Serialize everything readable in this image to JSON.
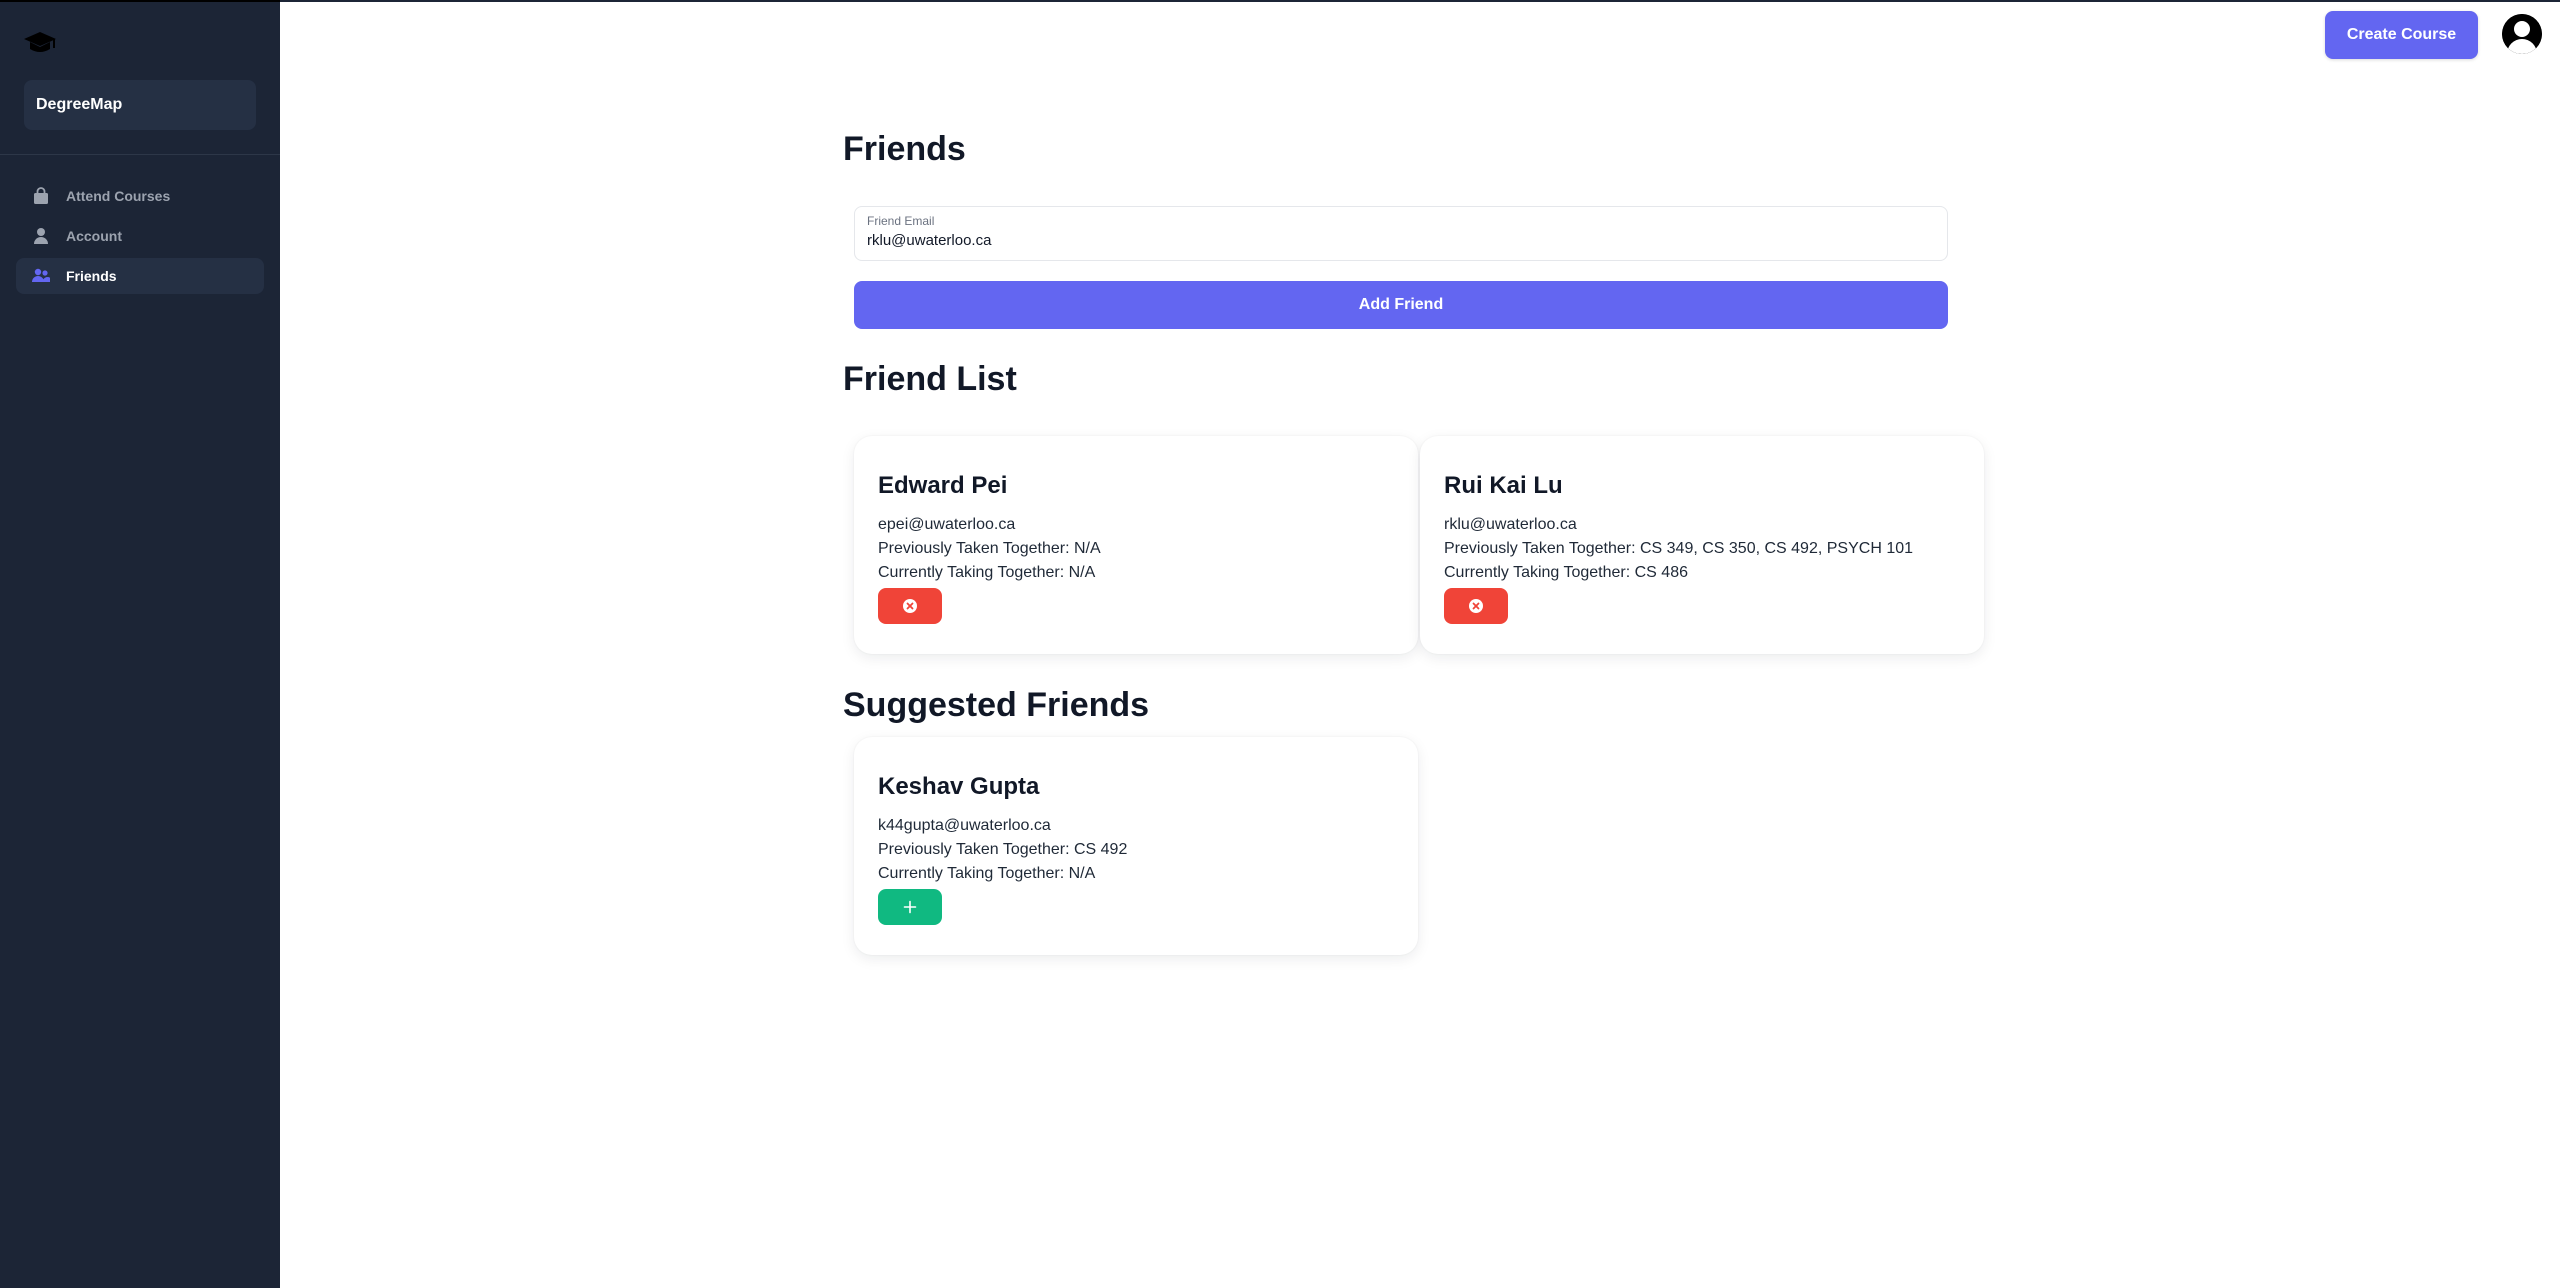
{
  "sidebar": {
    "workspace_name": "DegreeMap",
    "items": [
      {
        "label": "Attend Courses",
        "icon": "shopping-bag-icon",
        "active": false
      },
      {
        "label": "Account",
        "icon": "user-icon",
        "active": false
      },
      {
        "label": "Friends",
        "icon": "users-icon",
        "active": true
      }
    ]
  },
  "header": {
    "create_course_label": "Create Course"
  },
  "friends_page": {
    "title": "Friends",
    "email_label": "Friend Email",
    "email_value": "rklu@uwaterloo.ca",
    "add_friend_label": "Add Friend",
    "friend_list_title": "Friend List",
    "suggested_title": "Suggested Friends",
    "friends": [
      {
        "name": "Edward Pei",
        "email": "epei@uwaterloo.ca",
        "previously": "Previously Taken Together: N/A",
        "currently": "Currently Taking Together: N/A"
      },
      {
        "name": "Rui Kai Lu",
        "email": "rklu@uwaterloo.ca",
        "previously": "Previously Taken Together: CS 349, CS 350, CS 492, PSYCH 101",
        "currently": "Currently Taking Together: CS 486"
      }
    ],
    "suggested": [
      {
        "name": "Keshav Gupta",
        "email": "k44gupta@uwaterloo.ca",
        "previously": "Previously Taken Together: CS 492",
        "currently": "Currently Taking Together: N/A"
      }
    ]
  },
  "colors": {
    "sidebar_bg": "#1c2536",
    "primary": "#6366f1",
    "remove": "#f04438",
    "add": "#10b981"
  }
}
